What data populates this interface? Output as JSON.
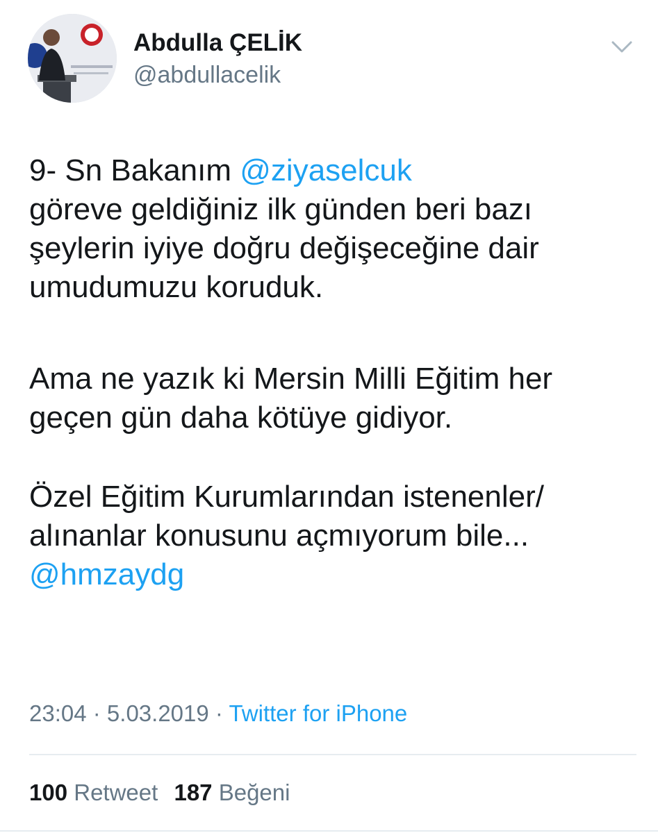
{
  "user": {
    "display_name": "Abdulla ÇELİK",
    "handle": "@abdullacelik",
    "avatar_icon": "profile-photo-speaker-at-podium"
  },
  "menu": {
    "icon": "chevron-down-icon"
  },
  "tweet": {
    "p1_prefix": "9- Sn Bakanım ",
    "p1_mention": "@ziyaselcuk",
    "p1_rest": "göreve geldiğiniz ilk günden beri bazı şeylerin iyiye doğru değişeceğine dair umudumuzu koruduk.",
    "p2": "Ama ne yazık ki Mersin Milli Eğitim her geçen gün daha kötüye gidiyor.",
    "p3": "Özel Eğitim Kurumlarından istenenler/ alınanlar konusunu açmıyorum bile...",
    "p4_mention": "@hmzaydg"
  },
  "meta": {
    "time": "23:04",
    "separator": " · ",
    "date": "5.03.2019",
    "source": "Twitter for iPhone"
  },
  "stats": {
    "retweet_count": "100",
    "retweet_label": "Retweet",
    "like_count": "187",
    "like_label": "Beğeni"
  },
  "colors": {
    "link": "#1da1f2",
    "text": "#14171a",
    "muted": "#657786",
    "divider": "#e6ecf0"
  }
}
